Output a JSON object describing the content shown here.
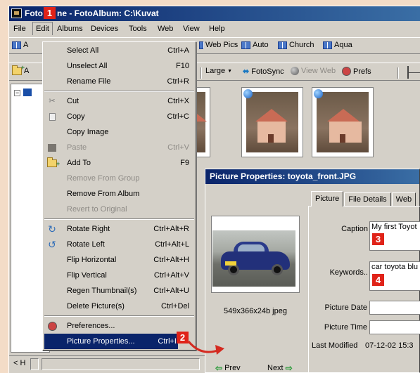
{
  "app": {
    "title": "FotoAlbum - FotoAlbum:  C:\\Kuvat"
  },
  "title_visible": {
    "part1": "Foto",
    "part2": "ne - FotoAlbum:  C:\\Kuvat"
  },
  "menubar": [
    {
      "label": "File"
    },
    {
      "label": "Edit"
    },
    {
      "label": "Albums"
    },
    {
      "label": "Devices"
    },
    {
      "label": "Tools"
    },
    {
      "label": "Web"
    },
    {
      "label": "View"
    },
    {
      "label": "Help"
    }
  ],
  "toolbar1": {
    "first": "A",
    "items": [
      "Web Pics",
      "Auto",
      "Church",
      "Aqua"
    ]
  },
  "toolbar2": {
    "first": "A",
    "large": "Large",
    "fotosync": "FotoSync",
    "viewweb": "View Web",
    "prefs": "Prefs"
  },
  "edit_menu": {
    "items": [
      {
        "label": "Select All",
        "shortcut": "Ctrl+A",
        "icon": "",
        "disabled": false
      },
      {
        "label": "Unselect All",
        "shortcut": "F10",
        "icon": "",
        "disabled": false
      },
      {
        "label": "Rename File",
        "shortcut": "Ctrl+R",
        "icon": "",
        "disabled": false
      },
      {
        "sep": true
      },
      {
        "label": "Cut",
        "shortcut": "Ctrl+X",
        "icon": "scissors-icon",
        "disabled": false
      },
      {
        "label": "Copy",
        "shortcut": "Ctrl+C",
        "icon": "copy-icon",
        "disabled": false
      },
      {
        "label": "Copy Image",
        "shortcut": "",
        "icon": "",
        "disabled": false
      },
      {
        "label": "Paste",
        "shortcut": "Ctrl+V",
        "icon": "paste-icon",
        "disabled": true
      },
      {
        "label": "Add To",
        "shortcut": "F9",
        "icon": "add-folder-icon",
        "disabled": false
      },
      {
        "label": "Remove From Group",
        "shortcut": "",
        "icon": "",
        "disabled": true
      },
      {
        "label": "Remove From Album",
        "shortcut": "",
        "icon": "",
        "disabled": false
      },
      {
        "label": "Revert to Original",
        "shortcut": "",
        "icon": "",
        "disabled": true
      },
      {
        "sep": true
      },
      {
        "label": "Rotate Right",
        "shortcut": "Ctrl+Alt+R",
        "icon": "rotate-right-icon",
        "disabled": false
      },
      {
        "label": "Rotate Left",
        "shortcut": "Ctrl+Alt+L",
        "icon": "rotate-left-icon",
        "disabled": false
      },
      {
        "label": "Flip Horizontal",
        "shortcut": "Ctrl+Alt+H",
        "icon": "",
        "disabled": false
      },
      {
        "label": "Flip Vertical",
        "shortcut": "Ctrl+Alt+V",
        "icon": "",
        "disabled": false
      },
      {
        "label": "Regen Thumbnail(s)",
        "shortcut": "Ctrl+Alt+U",
        "icon": "",
        "disabled": false
      },
      {
        "label": "Delete Picture(s)",
        "shortcut": "Ctrl+Del",
        "icon": "",
        "disabled": false
      },
      {
        "sep": true
      },
      {
        "label": "Preferences...",
        "shortcut": "",
        "icon": "preferences-icon",
        "disabled": false
      },
      {
        "label": "Picture Properties...",
        "shortcut": "Ctrl+I",
        "icon": "",
        "disabled": false,
        "selected": true
      }
    ]
  },
  "dialog": {
    "title": "Picture Properties:  toyota_front.JPG",
    "tabs": [
      "Picture",
      "File Details",
      "Web"
    ],
    "image_info": "549x366x24b jpeg",
    "fields": {
      "caption_label": "Caption",
      "caption_value": "My first Toyot",
      "keywords_label": "Keywords..",
      "keywords_value": "car toyota blu",
      "date_label": "Picture Date",
      "date_value": "",
      "time_label": "Picture Time",
      "time_value": "",
      "modified_label": "Last Modified",
      "modified_value": "07-12-02 15:3"
    },
    "prev": "Prev",
    "next": "Next"
  },
  "statusbar": {
    "label": "< H"
  },
  "callouts": [
    "1",
    "2",
    "3",
    "4"
  ],
  "colors": {
    "callout": "#e02319",
    "titlebar": "#0a246a",
    "selection": "#0a246a",
    "arrow": "#d42a20"
  }
}
